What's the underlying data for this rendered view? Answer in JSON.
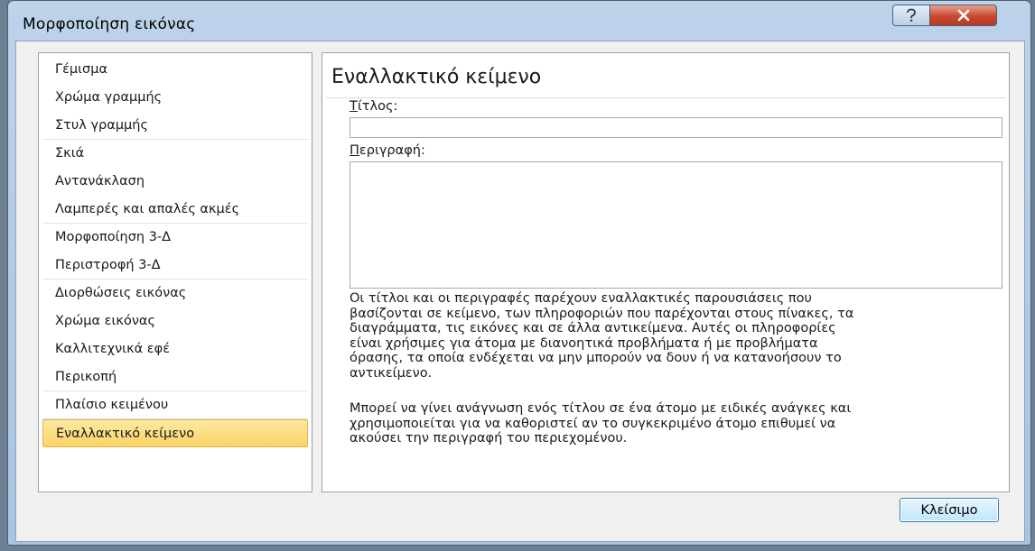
{
  "window": {
    "title": "Μορφοποίηση εικόνας",
    "help_icon": "question-icon",
    "close_icon": "close-x-icon",
    "close_glyph": "x",
    "help_glyph": "?"
  },
  "sidebar": {
    "items": [
      {
        "label": "Γέμισμα",
        "group_end": false,
        "selected": false
      },
      {
        "label": "Χρώμα γραμμής",
        "group_end": false,
        "selected": false
      },
      {
        "label": "Στυλ γραμμής",
        "group_end": true,
        "selected": false
      },
      {
        "label": "Σκιά",
        "group_end": false,
        "selected": false
      },
      {
        "label": "Αντανάκλαση",
        "group_end": false,
        "selected": false
      },
      {
        "label": "Λαμπερές και απαλές ακμές",
        "group_end": true,
        "selected": false
      },
      {
        "label": "Μορφοποίηση 3-Δ",
        "group_end": false,
        "selected": false
      },
      {
        "label": "Περιστροφή 3-Δ",
        "group_end": true,
        "selected": false
      },
      {
        "label": "Διορθώσεις εικόνας",
        "group_end": false,
        "selected": false
      },
      {
        "label": "Χρώμα εικόνας",
        "group_end": false,
        "selected": false
      },
      {
        "label": "Καλλιτεχνικά εφέ",
        "group_end": false,
        "selected": false
      },
      {
        "label": "Περικοπή",
        "group_end": true,
        "selected": false
      },
      {
        "label": "Πλαίσιο κειμένου",
        "group_end": true,
        "selected": false
      },
      {
        "label": "Εναλλακτικό κείμενο",
        "group_end": false,
        "selected": true
      }
    ]
  },
  "panel": {
    "title": "Εναλλακτικό κείμενο",
    "title_label_first": "Τ",
    "title_label_rest": "ίτλος:",
    "title_value": "",
    "description_label_first": "Π",
    "description_label_rest": "εριγραφή:",
    "description_value": "",
    "help_paragraph_1_lines": [
      "Οι τίτλοι και οι περιγραφές παρέχουν εναλλακτικές παρουσιάσεις που",
      "βασίζονται σε κείμενο, των πληροφοριών που παρέχονται στους πίνακες, τα",
      "διαγράμματα, τις εικόνες και σε άλλα αντικείμενα. Αυτές οι πληροφορίες",
      "είναι χρήσιμες για άτομα με διανοητικά προβλήματα ή με προβλήματα",
      "όρασης, τα οποία ενδέχεται να μην μπορούν να δουν ή να κατανοήσουν το",
      "αντικείμενο."
    ],
    "help_paragraph_2_lines": [
      "Μπορεί να γίνει ανάγνωση ενός τίτλου σε ένα άτομο με ειδικές ανάγκες και",
      "χρησιμοποιείται για να καθοριστεί αν το συγκεκριμένο άτομο επιθυμεί να",
      "ακούσει την περιγραφή του περιεχομένου."
    ]
  },
  "footer": {
    "close_label": "Κλείσιμο"
  }
}
